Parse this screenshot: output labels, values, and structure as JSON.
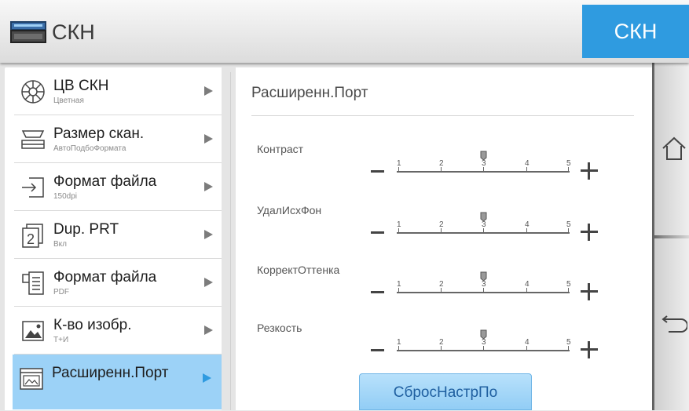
{
  "header": {
    "title": "СКН",
    "mode_button": "СКН"
  },
  "menu": {
    "items": [
      {
        "label": "ЦВ СКН",
        "sub": "Цветная",
        "icon": "color-wheel-icon"
      },
      {
        "label": "Размер скан.",
        "sub": "АвтоПодбоФормата",
        "icon": "scanner-size-icon"
      },
      {
        "label": "Формат файла",
        "sub": "150dpi",
        "icon": "resolution-icon"
      },
      {
        "label": "Dup. PRT",
        "sub": "Вкл",
        "icon": "duplex-icon"
      },
      {
        "label": "Формат файла",
        "sub": "PDF",
        "icon": "file-format-icon"
      },
      {
        "label": "К-во изобр.",
        "sub": "Т+И",
        "icon": "image-icon"
      },
      {
        "label": "Расширенн.Порт",
        "sub": "",
        "icon": "advanced-icon"
      }
    ],
    "selected_index": 6
  },
  "panel": {
    "title": "Расширенн.Порт",
    "scale_labels": [
      "1",
      "2",
      "3",
      "4",
      "5"
    ],
    "settings": [
      {
        "label": "Контраст",
        "value": 3
      },
      {
        "label": "УдалИсхФон",
        "value": 3
      },
      {
        "label": "КорректОттенка",
        "value": 3
      },
      {
        "label": "Резкость",
        "value": 3
      }
    ],
    "reset_button": "СбросНастрПо"
  },
  "side": {
    "home_icon": "home-icon",
    "back_icon": "back-icon"
  },
  "colors": {
    "accent": "#2f9be0",
    "selected": "#9cd2f7"
  }
}
